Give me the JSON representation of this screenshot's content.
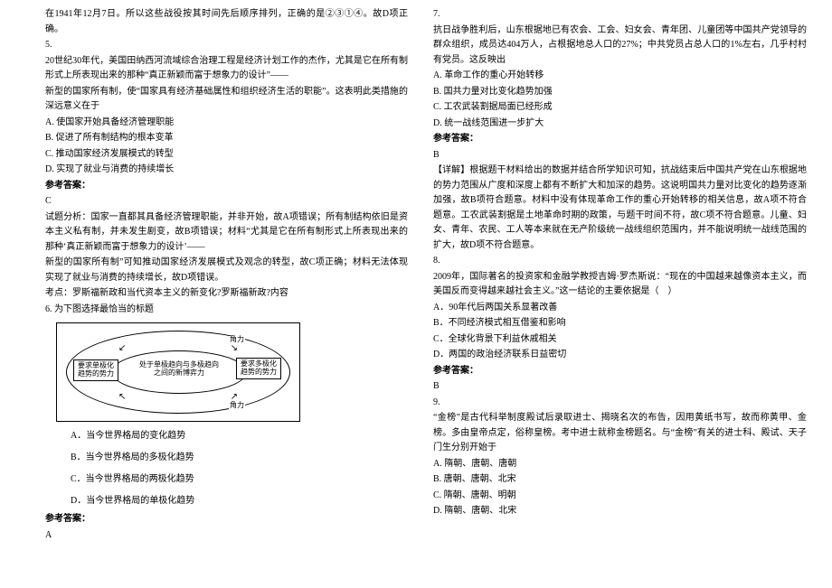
{
  "left": {
    "l0": "在1941年12月7日。所以这些战役按其时间先后顺序排列，正确的是②③①④。故D项正确。",
    "q5num": "5.",
    "l1": "20世纪30年代，美国田纳西河流域综合治理工程是经济计划工作的杰作，尤其是它在所有制形式上所表现出来的那种“真正新颖而富于想象力的设计”——",
    "l2": "新型的国家所有制，使“国家具有经济基础属性和组织经济生活的职能”。这表明此类措施的深远意义在于",
    "optA": "A. 使国家开始具备经济管理职能",
    "optB": "B. 促进了所有制结构的根本变革",
    "optC": "C. 推动国家经济发展模式的转型",
    "optD": "D. 实现了就业与消费的持续增长",
    "ansLabel": "参考答案：",
    "ans5": "C",
    "exp1": "试题分析：国家一直都其具备经济管理职能，并非开始，故A项错误；所有制结构依旧是资本主义私有制，并未发生剧变，故B项错误；材料“尤其是它在所有制形式上所表现出来的那种‘真正新颖而富于想象力的设计’——",
    "exp2": "新型的国家所有制”可知推动国家经济发展模式及观念的转型，故C项正确；材料无法体现实现了就业与消费的持续增长，故D项错误。",
    "exp3": "考点：罗斯福新政和当代资本主义的新变化?罗斯福新政?内容",
    "q6": "6. 为下图选择最恰当的标题",
    "dgLeft": "要求单极化趋势的势力",
    "dgCenter": "处于单极趋向与多极趋向之间的新博弈力",
    "dgRight": "要求多极化趋势的势力",
    "dgTop": "角力",
    "dgBottom": "角力",
    "q6A": "A．当今世界格局的变化趋势",
    "q6B": "B．当今世界格局的多极化趋势",
    "q6C": "C．当今世界格局的两极化趋势",
    "q6D": "D．当今世界格局的单极化趋势",
    "ans6": "A"
  },
  "right": {
    "q7num": "7.",
    "r1": "抗日战争胜利后，山东根据地已有农会、工会、妇女会、青年团、儿童团等中国共产党领导的群众组织，成员达404万人，占根据地总人口的27%；中共党员占总人口的1%左右，几乎村村有党员。这反映出",
    "rA": "A. 革命工作的重心开始转移",
    "rB": "B. 国共力量对比变化趋势加强",
    "rC": "C. 工农武装割据局面已经形成",
    "rD": "D. 统一战线范围进一步扩大",
    "ansLabel": "参考答案：",
    "ans7": "B",
    "exp": "【详解】根据题干材料给出的数据并结合所学知识可知，抗战结束后中国共产党在山东根据地的势力范围从广度和深度上都有不断扩大和加深的趋势。这说明国共力量对比变化的趋势逐渐加强，故B项符合题意。材料中没有体现革命工作的重心开始转移的相关信息，故A项不符合题意。工农武装割据是土地革命时期的政策，与题干时间不符，故C项不符合题意。儿童、妇女、青年、农民、工人等本来就在无产阶级统一战线组织范围内，并不能说明统一战线范围的扩大，故D项不符合题意。",
    "q8num": "8.",
    "r8a": "2009年，国际著名的投资家和金融学教授吉姆·罗杰斯说：“现在的中国越来越像资本主义，而美国反而变得越来越社会主义。”这一结论的主要依据是（　）",
    "r8A": "A．90年代后两国关系显著改善",
    "r8B": "B．不同经济模式相互借鉴和影响",
    "r8C": "C．全球化背景下利益休戚相关",
    "r8D": "D．两国的政治经济联系日益密切",
    "ans8": "B",
    "q9num": "9.",
    "r9": "“金榜”是古代科举制度殿试后录取进士、揭晓名次的布告，因用黄纸书写，故而称黄甲、金榜。多由皇帝点定，俗称皇榜。考中进士就称金榜题名。与“金榜”有关的进士科、殿试、天子门生分别开始于",
    "r9A": "A. 隋朝、唐朝、唐朝",
    "r9B": "B. 唐朝、唐朝、北宋",
    "r9C": "C. 隋朝、唐朝、明朝",
    "r9D": "D. 隋朝、唐朝、北宋"
  }
}
